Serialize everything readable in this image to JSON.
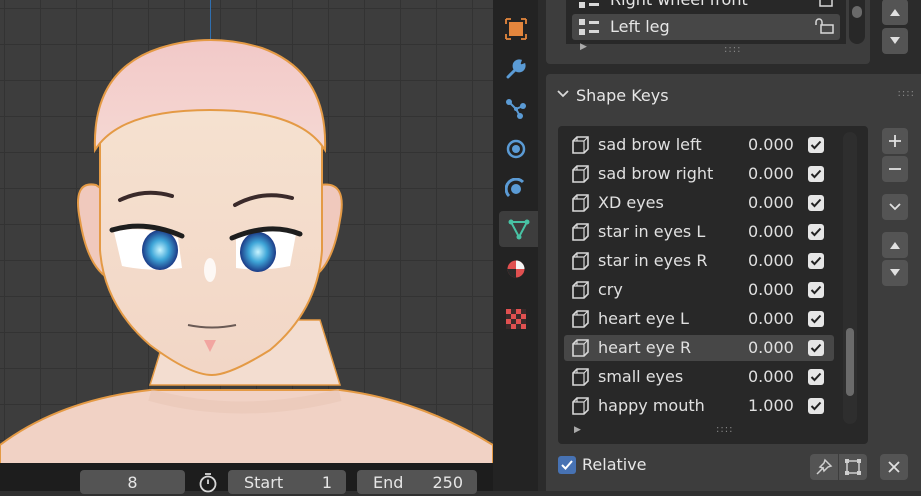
{
  "viewport": {
    "name": "3D viewport"
  },
  "timeline": {
    "current_frame": "8",
    "start_label": "Start",
    "start_value": "1",
    "end_label": "End",
    "end_value": "250"
  },
  "property_tabs": [
    {
      "icon": "object-icon",
      "color": "#e4863d"
    },
    {
      "icon": "wrench-modifier-icon",
      "color": "#5b9bd5"
    },
    {
      "icon": "particles-icon",
      "color": "#5b9bd5"
    },
    {
      "icon": "physics-icon",
      "color": "#5b9bd5"
    },
    {
      "icon": "constraints-icon",
      "color": "#5b9bd5"
    },
    {
      "icon": "mesh-data-icon",
      "color": "#48c2a4",
      "active": true
    },
    {
      "icon": "material-icon",
      "color": "#e05050"
    },
    {
      "icon": "texture-icon",
      "color": "#e05050"
    }
  ],
  "vertex_groups": {
    "items": [
      {
        "label": "Right wheel front"
      },
      {
        "label": "Left leg",
        "selected": true
      }
    ]
  },
  "shape_keys": {
    "title": "Shape Keys",
    "items": [
      {
        "name": "sad brow left",
        "value": "0.000"
      },
      {
        "name": "sad brow right",
        "value": "0.000"
      },
      {
        "name": "XD eyes",
        "value": "0.000"
      },
      {
        "name": "star in eyes L",
        "value": "0.000"
      },
      {
        "name": "star in eyes R",
        "value": "0.000"
      },
      {
        "name": "cry",
        "value": "0.000"
      },
      {
        "name": "heart eye L",
        "value": "0.000"
      },
      {
        "name": "heart eye R",
        "value": "0.000",
        "selected": true
      },
      {
        "name": "small eyes",
        "value": "0.000"
      },
      {
        "name": "happy mouth",
        "value": "1.000"
      }
    ],
    "relative_label": "Relative",
    "relative_checked": true
  },
  "colors": {
    "accent_blue": "#4772b3",
    "outline_orange": "#e49a45",
    "mesh_tab": "#48c2a4"
  }
}
